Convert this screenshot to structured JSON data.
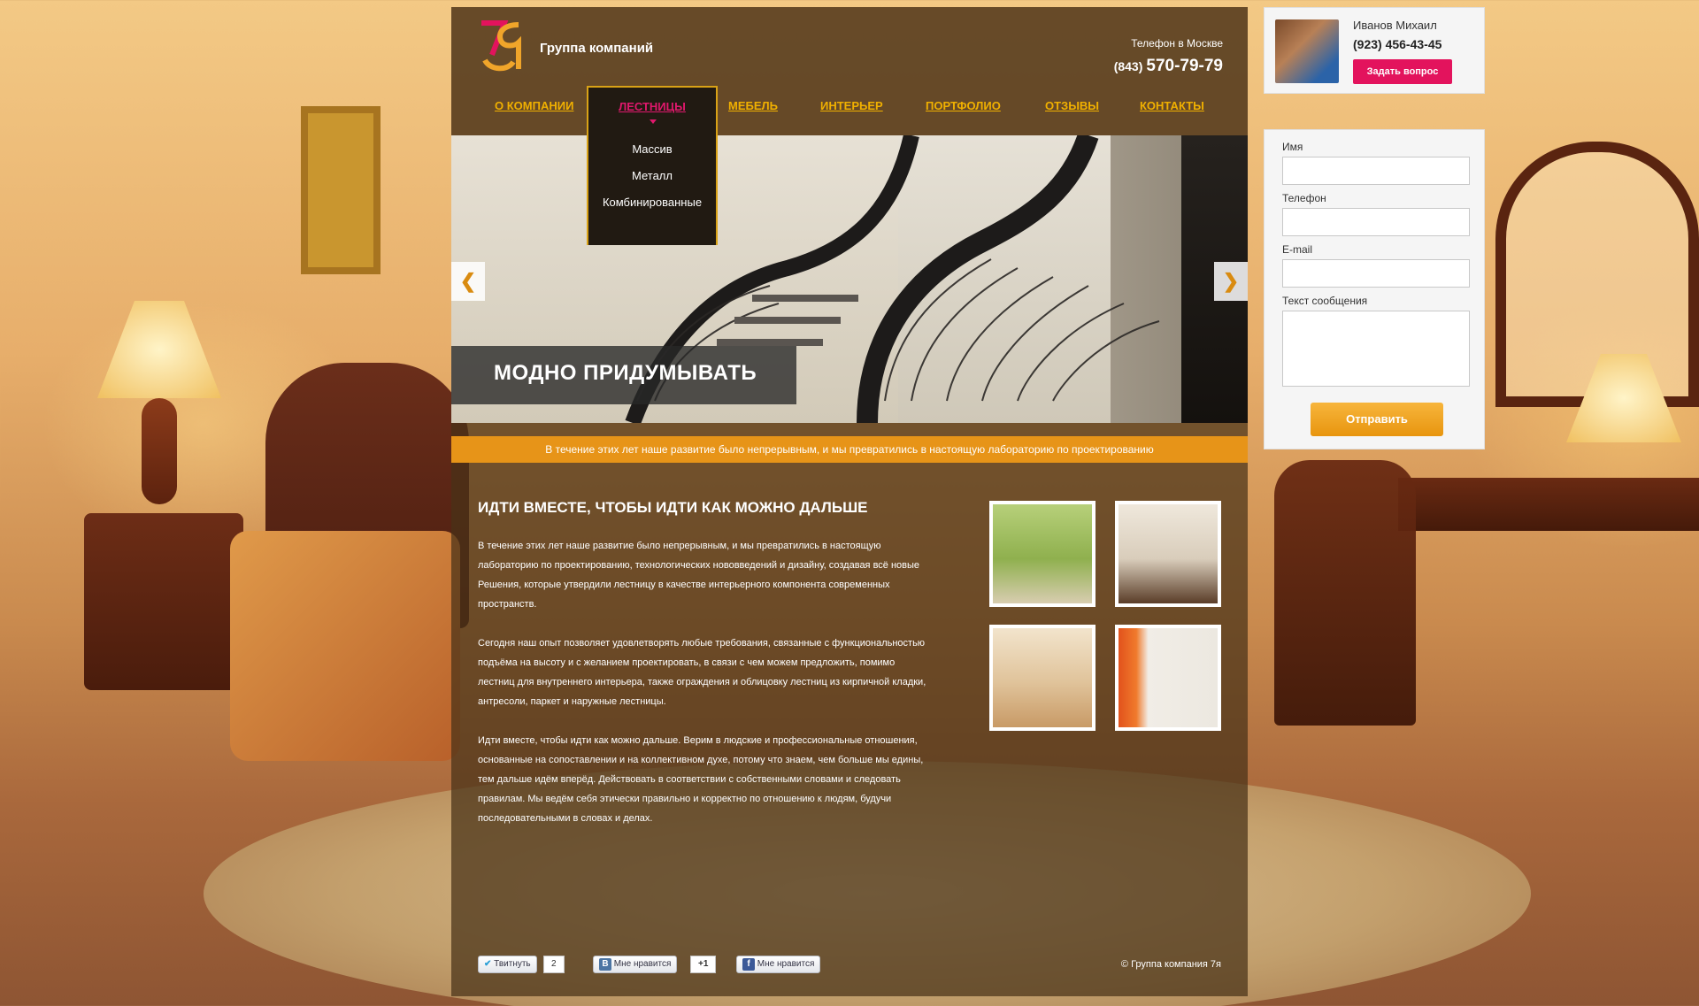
{
  "header": {
    "logo_text": "7я",
    "company_name": "Группа компаний",
    "phone_label": "Телефон в Москве",
    "phone_code": "(843)",
    "phone_number": "570-79-79"
  },
  "nav": {
    "items": [
      {
        "label": "О КОМПАНИИ"
      },
      {
        "label": "ЛЕСТНИЦЫ",
        "active": true
      },
      {
        "label": "МЕБЕЛЬ"
      },
      {
        "label": "ИНТЕРЬЕР"
      },
      {
        "label": "ПОРТФОЛИО"
      },
      {
        "label": "ОТЗЫВЫ"
      },
      {
        "label": "КОНТАКТЫ"
      }
    ],
    "dropdown": [
      "Массив",
      "Металл",
      "Комбинированные"
    ]
  },
  "slider": {
    "caption": "МОДНО ПРИДУМЫВАТЬ",
    "prev_arrow": "❮",
    "next_arrow": "❯"
  },
  "banner_text": "В течение этих лет наше развитие было непрерывным, и мы превратились в настоящую лабораторию по проектированию",
  "content": {
    "title": "ИДТИ ВМЕСТЕ, ЧТОБЫ ИДТИ КАК МОЖНО ДАЛЬШЕ",
    "paragraphs": [
      "В течение этих лет наше развитие было непрерывным, и мы превратились в  настоящую лабораторию по проектированию, технологических нововведений и дизайну, создавая всё новые Решения, которые утвердили лестницу в качестве интерьерного компонента современных пространств.",
      " Сегодня наш опыт позволяет удовлетворять любые требования, связанные с функциональностью подъёма на высоту и с желанием проектировать, в связи с чем можем предложить, помимо лестниц для внутреннего интерьера, также ограждения и облицовку лестниц из кирпичной кладки, антресоли, паркет и наружные лестницы.",
      "Идти вместе, чтобы идти как можно дальше. Верим в людские и профессиональные отношения, основанные на сопоставлении и на коллективном духе, потому что знаем, чем больше мы едины, тем дальше идём вперёд. Действовать в соответствии с собственными словами и следовать правилам. Мы ведём себя этически правильно и корректно по отношению к людям, будучи последовательными в словах и делах."
    ]
  },
  "thumbnails": [
    {
      "name": "green-bedroom"
    },
    {
      "name": "modern-living"
    },
    {
      "name": "dining-room"
    },
    {
      "name": "orange-curtain-room"
    }
  ],
  "social": {
    "tweet_label": "Твитнуть",
    "tweet_count": "2",
    "vk_label": "Мне нравится",
    "vk_icon": "В",
    "gplus_label": "+1",
    "fb_label": "Мне нравится",
    "fb_icon": "f"
  },
  "footer": {
    "copyright": "© Группа компания 7я"
  },
  "contact": {
    "name": "Иванов Михаил",
    "phone": "(923) 456-43-45",
    "ask_button": "Задать вопрос"
  },
  "form": {
    "name_label": "Имя",
    "phone_label": "Телефон",
    "email_label": "E-mail",
    "message_label": "Текст сообщения",
    "submit_label": "Отправить"
  },
  "colors": {
    "nav_link": "#f0b000",
    "nav_active": "#e0186c",
    "banner": "#e79418",
    "ask_button": "#e3135d",
    "submit_button": "#f0a52a"
  }
}
